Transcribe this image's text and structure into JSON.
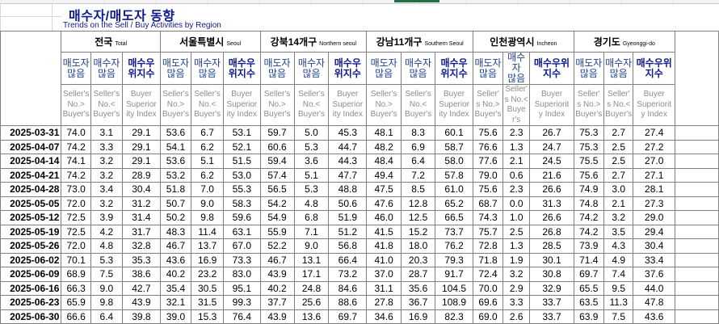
{
  "title": "매수자/매도자 동향",
  "subtitle": "Trends on the Sell / Buy Activities by Region",
  "columns": {
    "kr": [
      "매도자\n많음",
      "매수자\n많음",
      "매수우\n위지수"
    ],
    "en": [
      "Seller's\nNo.>\nBuyer's",
      "Seller's\nNo.<\nBuyer's",
      "Buyer\nSuperior\nity Index"
    ],
    "kr_alt": [
      "매도자\n많음",
      "매수자\n많음",
      "매수우위\n지수"
    ],
    "en_alt": [
      "Seller'\ns No.>\nBuyer's",
      "Seller'\ns No.<\nBuyer's",
      "Buyer\nSuperiorit\ny Index"
    ]
  },
  "regions": [
    {
      "kr": "전국",
      "en": "Total",
      "kr_cols": [
        "매도자\n많음",
        "매수자\n많음",
        "매수우\n위지수"
      ],
      "en_cols": [
        "Seller's\nNo.>\nBuyer's",
        "Seller's\nNo.<\nBuyer's",
        "Buyer\nSuperior\nity Index"
      ]
    },
    {
      "kr": "서울특별시",
      "en": "Seoul",
      "kr_cols": [
        "매도자\n많음",
        "매수자\n많음",
        "매수우\n위지수"
      ],
      "en_cols": [
        "Seller's\nNo.>\nBuyer's",
        "Seller's\nNo.<\nBuyer's",
        "Buyer\nSuperior\nity Index"
      ]
    },
    {
      "kr": "강북14개구",
      "en": "Northern seoul",
      "kr_cols": [
        "매도자\n많음",
        "매수자\n많음",
        "매수우\n위지수"
      ],
      "en_cols": [
        "Seller's\nNo.>\nBuyer's",
        "Seller's\nNo.<\nBuyer's",
        "Buyer\nSuperior\nity Index"
      ]
    },
    {
      "kr": "강남11개구",
      "en": "Southern Seoul",
      "kr_cols": [
        "매도자\n많음",
        "매수자\n많음",
        "매수우\n위지수"
      ],
      "en_cols": [
        "Seller's\nNo.>\nBuyer's",
        "Seller's\nNo.<\nBuyer's",
        "Buyer\nSuperior\nity Index"
      ]
    },
    {
      "kr": "인천광역시",
      "en": "Incheon",
      "kr_cols": [
        "매도자\n많음",
        "매수자\n많음",
        "매수우위\n지수"
      ],
      "en_cols": [
        "Seller'\ns No.>\nBuyer's",
        "Seller'\ns No.<\nBuyer's",
        "Buyer\nSuperiorit\ny Index"
      ]
    },
    {
      "kr": "경기도",
      "en": "Gyeonggi-do",
      "kr_cols": [
        "매도자\n많음",
        "매수자\n많음",
        "매수우위\n지수"
      ],
      "en_cols": [
        "Seller'\ns No.>\nBuyer's",
        "Seller'\ns No.<\nBuyer's",
        "Buyer\nSuperiorit\ny Index"
      ]
    }
  ],
  "rows": [
    {
      "date": "2025-03-31",
      "values": [
        "74.0",
        "3.1",
        "29.1",
        "53.6",
        "6.7",
        "53.1",
        "59.7",
        "5.0",
        "45.3",
        "48.1",
        "8.3",
        "60.1",
        "75.6",
        "2.3",
        "26.7",
        "75.3",
        "2.7",
        "27.4"
      ]
    },
    {
      "date": "2025-04-07",
      "values": [
        "74.2",
        "3.3",
        "29.1",
        "54.1",
        "6.2",
        "52.1",
        "60.6",
        "5.3",
        "44.7",
        "48.2",
        "6.9",
        "58.7",
        "76.6",
        "1.3",
        "24.7",
        "75.3",
        "2.5",
        "27.2"
      ]
    },
    {
      "date": "2025-04-14",
      "values": [
        "74.1",
        "3.2",
        "29.1",
        "53.6",
        "5.1",
        "51.5",
        "59.4",
        "3.6",
        "44.3",
        "48.4",
        "6.4",
        "58.0",
        "77.6",
        "2.1",
        "24.5",
        "75.5",
        "2.5",
        "27.0"
      ]
    },
    {
      "date": "2025-04-21",
      "values": [
        "74.2",
        "3.2",
        "28.9",
        "53.2",
        "6.2",
        "53.0",
        "57.4",
        "5.1",
        "47.7",
        "49.4",
        "7.2",
        "57.8",
        "79.0",
        "0.6",
        "21.6",
        "75.6",
        "2.7",
        "27.1"
      ]
    },
    {
      "date": "2025-04-28",
      "values": [
        "73.0",
        "3.4",
        "30.4",
        "51.8",
        "7.0",
        "55.3",
        "56.5",
        "5.3",
        "48.8",
        "47.5",
        "8.5",
        "61.0",
        "75.6",
        "2.3",
        "26.6",
        "74.9",
        "3.0",
        "28.1"
      ]
    },
    {
      "date": "2025-05-05",
      "values": [
        "72.0",
        "3.2",
        "31.2",
        "50.7",
        "9.0",
        "58.3",
        "54.2",
        "4.8",
        "50.6",
        "47.6",
        "12.8",
        "65.2",
        "68.7",
        "0.0",
        "31.3",
        "74.8",
        "2.1",
        "27.3"
      ]
    },
    {
      "date": "2025-05-12",
      "values": [
        "72.5",
        "3.9",
        "31.4",
        "50.2",
        "9.8",
        "59.6",
        "54.9",
        "6.8",
        "51.9",
        "46.0",
        "12.5",
        "66.5",
        "74.3",
        "1.0",
        "26.6",
        "74.2",
        "3.2",
        "29.0"
      ]
    },
    {
      "date": "2025-05-19",
      "values": [
        "72.5",
        "4.2",
        "31.7",
        "48.3",
        "11.4",
        "63.1",
        "55.9",
        "7.1",
        "51.2",
        "41.5",
        "15.2",
        "73.7",
        "75.7",
        "2.5",
        "26.8",
        "74.2",
        "3.5",
        "29.4"
      ]
    },
    {
      "date": "2025-05-26",
      "values": [
        "72.0",
        "4.8",
        "32.8",
        "46.7",
        "13.7",
        "67.0",
        "52.2",
        "9.0",
        "56.8",
        "41.8",
        "18.0",
        "76.2",
        "72.8",
        "1.3",
        "28.5",
        "73.9",
        "4.3",
        "30.4"
      ]
    },
    {
      "date": "2025-06-02",
      "values": [
        "70.1",
        "5.3",
        "35.3",
        "43.6",
        "16.9",
        "73.3",
        "46.7",
        "13.1",
        "66.4",
        "41.0",
        "20.3",
        "79.3",
        "71.8",
        "1.9",
        "30.1",
        "71.4",
        "4.9",
        "33.4"
      ]
    },
    {
      "date": "2025-06-09",
      "values": [
        "68.9",
        "7.5",
        "38.6",
        "40.2",
        "23.2",
        "83.0",
        "43.9",
        "17.1",
        "73.2",
        "37.0",
        "28.7",
        "91.7",
        "72.4",
        "3.2",
        "30.8",
        "69.7",
        "7.4",
        "37.6"
      ]
    },
    {
      "date": "2025-06-16",
      "values": [
        "66.3",
        "9.0",
        "42.7",
        "35.4",
        "30.5",
        "95.1",
        "40.2",
        "24.8",
        "84.6",
        "31.1",
        "35.6",
        "104.5",
        "70.0",
        "2.9",
        "32.9",
        "65.5",
        "9.5",
        "44.0"
      ]
    },
    {
      "date": "2025-06-23",
      "values": [
        "65.9",
        "9.8",
        "43.9",
        "32.1",
        "31.5",
        "99.3",
        "37.7",
        "25.6",
        "88.6",
        "27.8",
        "36.7",
        "108.9",
        "69.6",
        "3.3",
        "33.7",
        "63.5",
        "11.3",
        "47.8"
      ]
    },
    {
      "date": "2025-06-30",
      "values": [
        "66.6",
        "6.4",
        "39.8",
        "39.0",
        "15.3",
        "76.4",
        "43.9",
        "13.6",
        "69.7",
        "34.6",
        "16.9",
        "82.3",
        "69.0",
        "2.6",
        "33.7",
        "63.9",
        "7.5",
        "43.6"
      ]
    }
  ]
}
